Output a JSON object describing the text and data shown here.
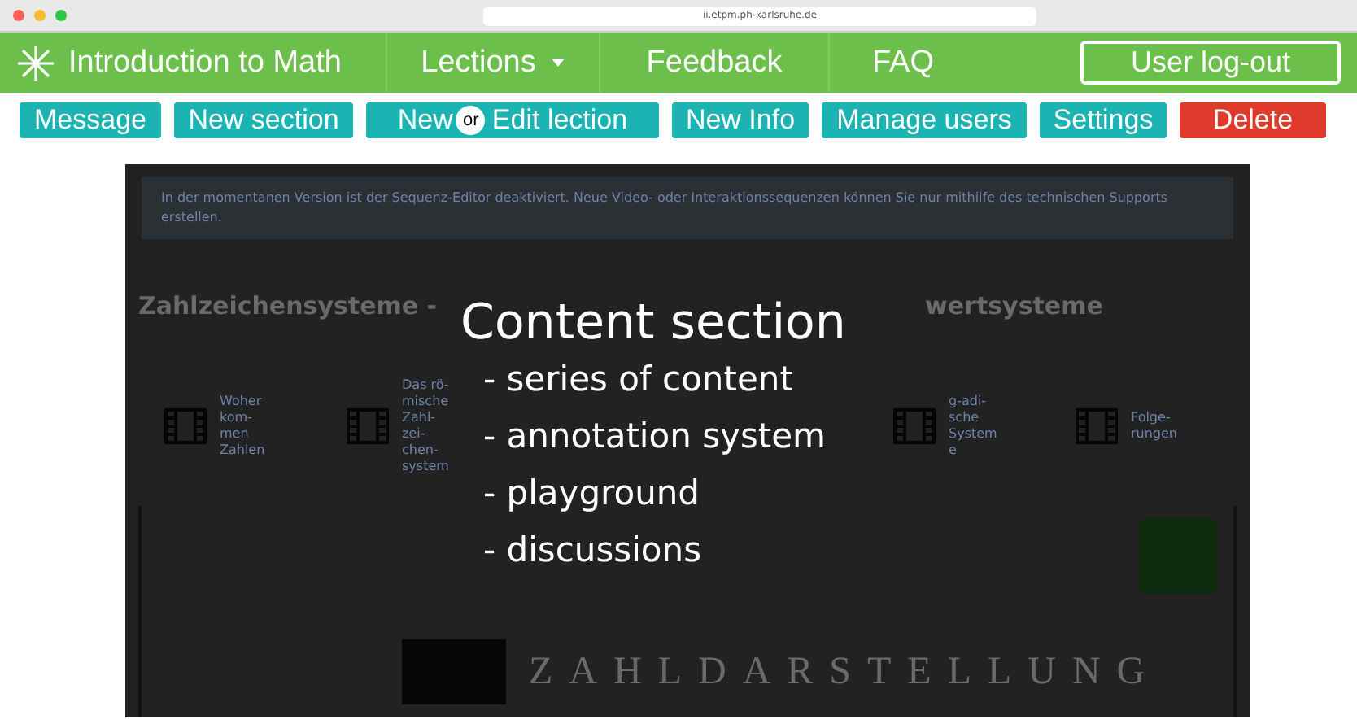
{
  "browser": {
    "url": "ii.etpm.ph-karlsruhe.de"
  },
  "nav": {
    "title": "Introduction to Math",
    "items": [
      {
        "label": "Lections",
        "dropdown": true
      },
      {
        "label": "Feedback",
        "dropdown": false
      },
      {
        "label": "FAQ",
        "dropdown": false
      }
    ],
    "logout": "User log-out"
  },
  "toolbar": [
    {
      "kind": "plain",
      "label": "Message",
      "danger": false
    },
    {
      "kind": "plain",
      "label": "New section",
      "danger": false
    },
    {
      "kind": "or",
      "label": "New",
      "or": "or",
      "label_2": "Edit lection",
      "danger": false
    },
    {
      "kind": "plain",
      "label": "New Info",
      "danger": false
    },
    {
      "kind": "plain",
      "label": "Manage users",
      "danger": false
    },
    {
      "kind": "plain",
      "label": "Settings",
      "danger": false
    },
    {
      "kind": "plain",
      "label": "Delete",
      "danger": true
    }
  ],
  "content": {
    "notice": "In der momentanen Version ist der Sequenz-Editor deaktiviert. Neue Video- oder Interaktionssequenzen können Sie nur mithilfe des technischen Supports erstellen.",
    "heading_parts": [
      "Zahlzeichensysteme -",
      "wertsysteme"
    ],
    "tiles": [
      {
        "kind": "sequence",
        "label": "Woher kom-men Zahlen"
      },
      {
        "kind": "sequence",
        "label": "Das rö-mische Zahl-zei-chen-system"
      },
      {
        "kind": "covered"
      },
      {
        "kind": "covered"
      },
      {
        "kind": "sequence",
        "label": "g-adi-sche System e"
      },
      {
        "kind": "sequence",
        "label": "Folge-rungen"
      }
    ],
    "banner": "ZAHLDARSTELLUNG"
  },
  "overlay": {
    "title": "Content section",
    "bullets": [
      "- series of content",
      "- annotation system",
      "- playground",
      "- discussions"
    ]
  }
}
